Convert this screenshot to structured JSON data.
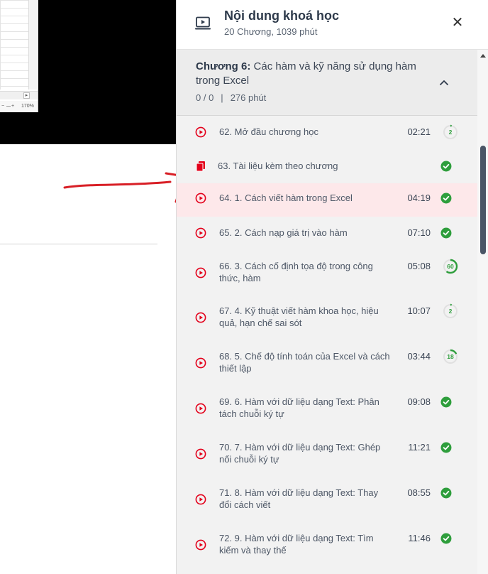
{
  "left": {
    "spreadsheet": {
      "zoom_minus": "−",
      "zoom_plus": "+",
      "zoom_level": "170%",
      "scroll_arrow": "▸"
    }
  },
  "sidebar": {
    "title": "Nội dung khoá học",
    "subtitle": "20 Chương, 1039 phút",
    "close_label": "✕",
    "icons": {
      "course": "laptop-play-icon",
      "close": "close-icon",
      "collapse": "chevron-up-icon"
    },
    "chapter": {
      "label": "Chương 6:",
      "name": "Các hàm và kỹ năng sử dụng hàm trong Excel",
      "progress": "0 / 0",
      "separator": "|",
      "duration": "276 phút"
    },
    "colors": {
      "accent": "#e3001b",
      "done": "#2e9e3c",
      "active_row": "#fde8ea"
    },
    "lessons": [
      {
        "title": "62. Mở đầu chương học",
        "duration": "02:21",
        "type": "video",
        "status": "progress",
        "progress_value": "2",
        "progress_fraction": 0.02
      },
      {
        "title": "63. Tài liệu kèm theo chương",
        "duration": "",
        "type": "document",
        "status": "done"
      },
      {
        "title": "64. 1. Cách viết hàm trong Excel",
        "duration": "04:19",
        "type": "video",
        "status": "done",
        "active": true
      },
      {
        "title": "65. 2. Cách nạp giá trị vào hàm",
        "duration": "07:10",
        "type": "video",
        "status": "done"
      },
      {
        "title": "66. 3. Cách cố định tọa độ trong công thức, hàm",
        "duration": "05:08",
        "type": "video",
        "status": "progress",
        "progress_value": "60",
        "progress_fraction": 0.6
      },
      {
        "title": "67. 4. Kỹ thuật viết hàm khoa học, hiệu quả, hạn chế sai sót",
        "duration": "10:07",
        "type": "video",
        "status": "progress",
        "progress_value": "2",
        "progress_fraction": 0.02
      },
      {
        "title": "68. 5. Chế độ tính toán của Excel và cách thiết lập",
        "duration": "03:44",
        "type": "video",
        "status": "progress",
        "progress_value": "18",
        "progress_fraction": 0.18
      },
      {
        "title": "69. 6. Hàm với dữ liệu dạng Text: Phân tách chuỗi ký tự",
        "duration": "09:08",
        "type": "video",
        "status": "done"
      },
      {
        "title": "70. 7. Hàm với dữ liệu dạng Text: Ghép nối chuỗi ký tự",
        "duration": "11:21",
        "type": "video",
        "status": "done"
      },
      {
        "title": "71. 8. Hàm với dữ liệu dạng Text: Thay đổi cách viết",
        "duration": "08:55",
        "type": "video",
        "status": "done"
      },
      {
        "title": "72. 9. Hàm với dữ liệu dạng Text: Tìm kiếm và thay thế",
        "duration": "11:46",
        "type": "video",
        "status": "done"
      }
    ]
  }
}
